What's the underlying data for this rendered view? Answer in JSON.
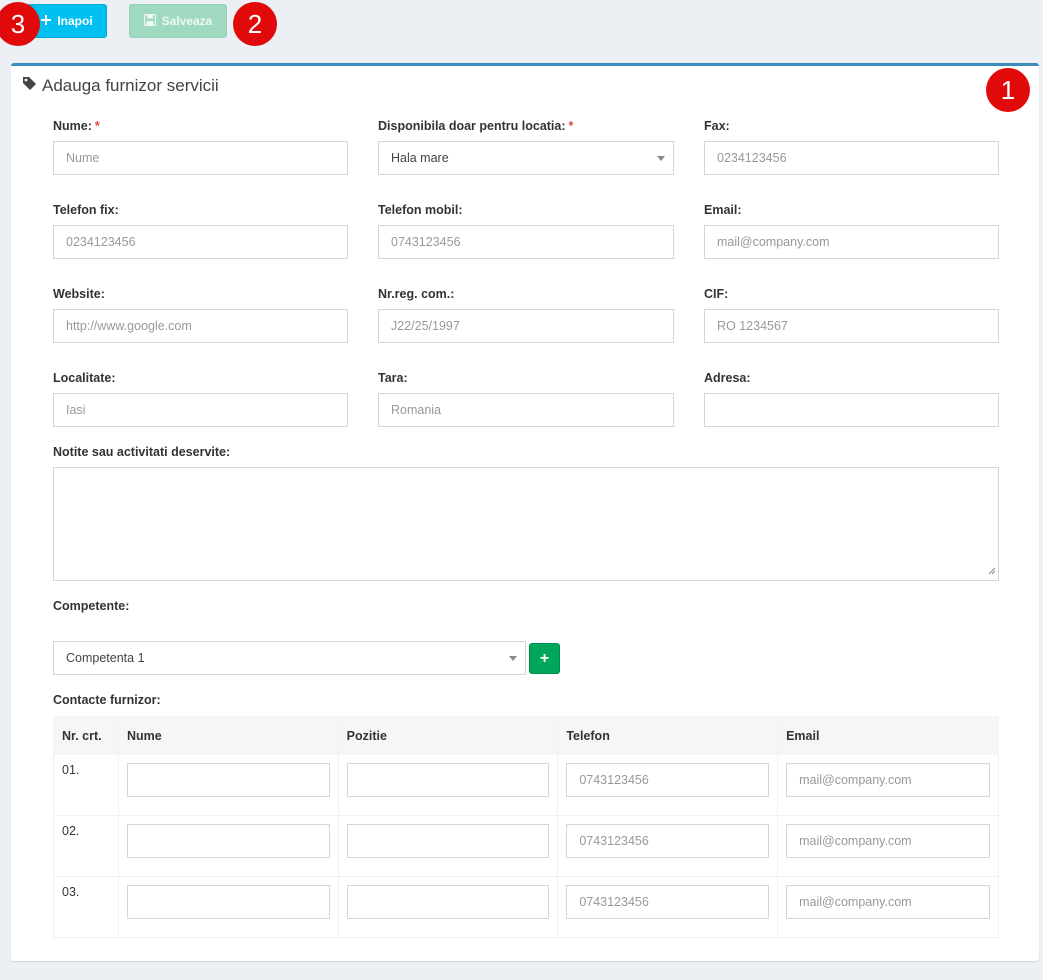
{
  "toolbar": {
    "back_label": "Inapoi",
    "save_label": "Salveaza"
  },
  "badges": [
    "1",
    "2",
    "3"
  ],
  "panel": {
    "title": "Adauga furnizor servicii",
    "icon": "tag-icon",
    "accent_color": "#3c8dbc"
  },
  "form": {
    "nume": {
      "label": "Nume:",
      "required": "*",
      "placeholder": "Nume"
    },
    "locatia": {
      "label": "Disponibila doar pentru locatia:",
      "required": "*",
      "value": "Hala mare"
    },
    "fax": {
      "label": "Fax:",
      "placeholder": "0234123456"
    },
    "telefon_fix": {
      "label": "Telefon fix:",
      "placeholder": "0234123456"
    },
    "telefon_mobil": {
      "label": "Telefon mobil:",
      "placeholder": "0743123456"
    },
    "email": {
      "label": "Email:",
      "placeholder": "mail@company.com"
    },
    "website": {
      "label": "Website:",
      "placeholder": "http://www.google.com"
    },
    "nr_reg": {
      "label": "Nr.reg. com.:",
      "placeholder": "J22/25/1997"
    },
    "cif": {
      "label": "CIF:",
      "placeholder": "RO 1234567"
    },
    "localitate": {
      "label": "Localitate:",
      "placeholder": "Iasi"
    },
    "tara": {
      "label": "Tara:",
      "placeholder": "Romania"
    },
    "adresa": {
      "label": "Adresa:",
      "placeholder": ""
    },
    "notite": {
      "label": "Notite sau activitati deservite:"
    },
    "competente": {
      "label": "Competente:",
      "value": "Competenta 1",
      "add_label": "+"
    }
  },
  "contacts": {
    "label": "Contacte furnizor:",
    "headers": [
      "Nr. crt.",
      "Nume",
      "Pozitie",
      "Telefon",
      "Email"
    ],
    "rows": [
      {
        "nr": "01.",
        "telefon_placeholder": "0743123456",
        "email_placeholder": "mail@company.com"
      },
      {
        "nr": "02.",
        "telefon_placeholder": "0743123456",
        "email_placeholder": "mail@company.com"
      },
      {
        "nr": "03.",
        "telefon_placeholder": "0743123456",
        "email_placeholder": "mail@company.com"
      }
    ]
  }
}
